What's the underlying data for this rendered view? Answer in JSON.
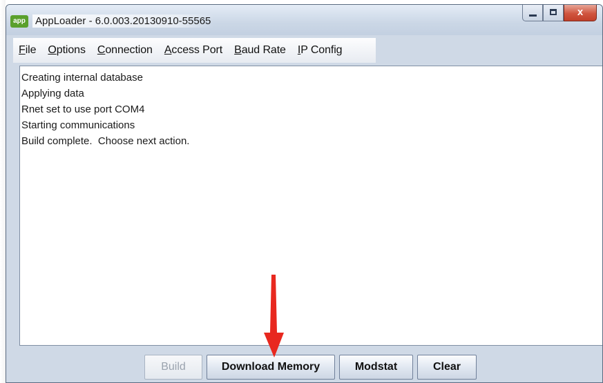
{
  "window": {
    "title": "AppLoader - 6.0.003.20130910-55565",
    "app_icon_text": "app"
  },
  "window_controls": {
    "close_glyph": "x"
  },
  "menubar": {
    "items": [
      {
        "mnemonic": "F",
        "rest": "ile"
      },
      {
        "mnemonic": "O",
        "rest": "ptions"
      },
      {
        "mnemonic": "C",
        "rest": "onnection"
      },
      {
        "mnemonic": "A",
        "rest": "ccess Port"
      },
      {
        "mnemonic": "B",
        "rest": "aud Rate"
      },
      {
        "mnemonic": "I",
        "rest": "P Config"
      }
    ]
  },
  "output": {
    "lines": [
      "Creating internal database",
      "Applying data",
      "Rnet set to use port COM4",
      "Starting communications",
      "Build complete.  Choose next action."
    ]
  },
  "buttons": {
    "build": "Build",
    "download_memory": "Download Memory",
    "modstat": "Modstat",
    "clear": "Clear"
  },
  "annotation": {
    "arrow_color": "#e8281f"
  }
}
